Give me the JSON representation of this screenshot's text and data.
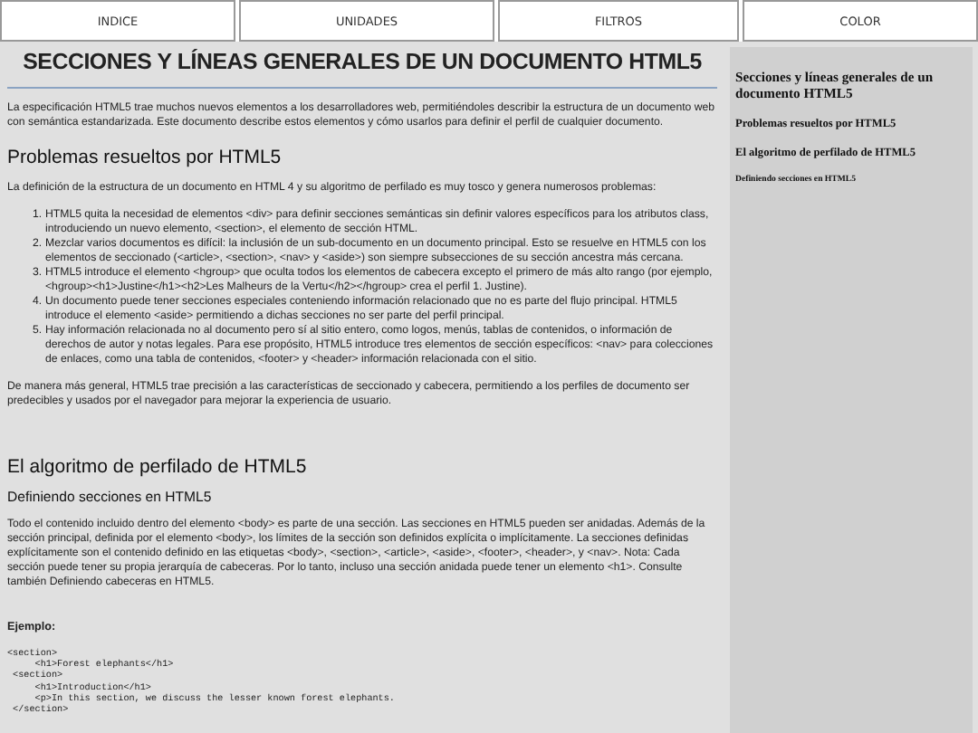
{
  "nav": [
    {
      "label": "INDICE"
    },
    {
      "label": "UNIDADES"
    },
    {
      "label": "FILTROS"
    },
    {
      "label": "COLOR"
    }
  ],
  "main": {
    "title": "SECCIONES Y LÍNEAS GENERALES DE UN DOCUMENTO HTML5",
    "intro": "La especificación HTML5 trae muchos nuevos elementos a los desarrolladores web, permitiéndoles describir la estructura de un documento web con semántica estandarizada. Este documento describe estos elementos y cómo usarlos para definir el perfil de cualquier documento.",
    "sections": [
      {
        "heading": "Problemas resueltos por HTML5",
        "lead": "La definición de la estructura de un documento en HTML 4 y su algoritmo de perfilado es muy tosco y genera numerosos problemas:",
        "items": [
          {
            "number": "1.",
            "text": "HTML5 quita la necesidad de elementos <div> para definir secciones semánticas sin definir valores específicos para los atributos class, introduciendo un nuevo elemento, <section>, el elemento de sección HTML."
          },
          {
            "number": "2.",
            "text": "Mezclar varios documentos es difícil: la inclusión de un sub-documento en un documento principal. Esto se resuelve en HTML5 con los elementos de seccionado (<article>, <section>, <nav> y <aside>) son siempre subsecciones de su sección ancestra más cercana."
          },
          {
            "number": "3.",
            "text": "HTML5 introduce el elemento <hgroup> que oculta todos los elementos de cabecera excepto el primero de más alto rango (por ejemplo, <hgroup><h1>Justine</h1><h2>Les Malheurs de la Vertu</h2></hgroup> crea el perfil 1. Justine)."
          },
          {
            "number": "4.",
            "text": "Un documento puede tener secciones especiales conteniendo información relacionado que no es parte del flujo principal. HTML5 introduce el elemento <aside> permitiendo a dichas secciones no ser parte del perfil principal."
          },
          {
            "number": "5.",
            "text": "Hay información relacionada no al documento pero sí al sitio entero, como logos, menús, tablas de contenidos, o información de derechos de autor y notas legales. Para ese propósito, HTML5 introduce tres elementos de sección específicos: <nav> para colecciones de enlaces, como una tabla de contenidos, <footer> y <header> información relacionada con el sitio."
          }
        ],
        "closing": "De manera más general, HTML5 trae precisión a las características de seccionado y cabecera, permitiendo a los perfiles de documento ser predecibles y usados por el navegador para mejorar la experiencia de usuario."
      },
      {
        "heading": "El algoritmo de perfilado de HTML5",
        "subheading": "Definiendo secciones en HTML5",
        "paragraph": "Todo el contenido incluido dentro del elemento <body> es parte de una sección. Las secciones en HTML5 pueden ser anidadas. Además de la sección principal, definida por el elemento <body>, los límites de la sección son definidos explícita o implícitamente. La secciones definidas explícitamente son el contenido definido en las etiquetas <body>, <section>, <article>, <aside>, <footer>, <header>, y <nav>. Nota: Cada sección puede tener su propia jerarquía de cabeceras. Por lo tanto, incluso una sección anidada puede tener un elemento <h1>. Consulte también Definiendo cabeceras en HTML5.",
        "example_label": "Ejemplo:",
        "code": [
          "<section>",
          "     <h1>Forest elephants</h1>",
          " <section>",
          "     <h1>Introduction</h1>",
          "     <p>In this section, we discuss the lesser known forest elephants.",
          " </section>"
        ]
      }
    ]
  },
  "sidebar": {
    "links": [
      {
        "kind": "h1",
        "label": "Secciones y líneas generales de un documento HTML5"
      },
      {
        "kind": "h2",
        "label": "Problemas resueltos por HTML5"
      },
      {
        "kind": "h2",
        "label": "El algoritmo de perfilado de HTML5"
      },
      {
        "kind": "h3",
        "label": "Definiendo secciones en HTML5"
      }
    ]
  }
}
